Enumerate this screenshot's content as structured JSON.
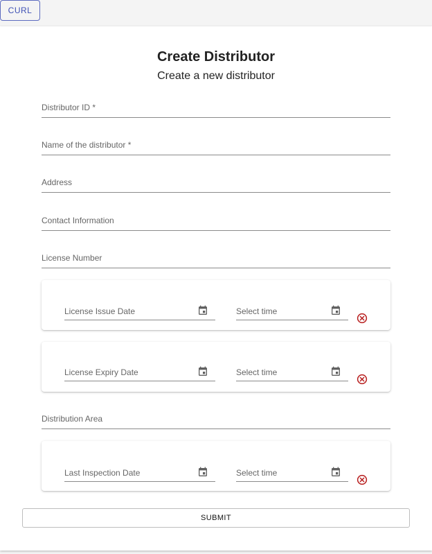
{
  "toolbar": {
    "curl_label": "CURL"
  },
  "form": {
    "title": "Create Distributor",
    "subtitle": "Create a new distributor",
    "fields": {
      "distributor_id": "Distributor ID *",
      "name": "Name of the distributor *",
      "address": "Address",
      "contact": "Contact Information",
      "license_number": "License Number",
      "distribution_area": "Distribution Area"
    },
    "license_issue": {
      "date_label": "License Issue Date",
      "time_label": "Select time"
    },
    "license_expiry": {
      "date_label": "License Expiry Date",
      "time_label": "Select time"
    },
    "last_inspection": {
      "date_label": "Last Inspection Date",
      "time_label": "Select time"
    },
    "submit_label": "SUBMIT"
  },
  "colors": {
    "accent": "#3f51b5",
    "error_icon": "#b71c1c",
    "icon_gray": "#616161"
  },
  "icons": {
    "calendar": "calendar-icon",
    "clear": "clear-circle-icon"
  }
}
